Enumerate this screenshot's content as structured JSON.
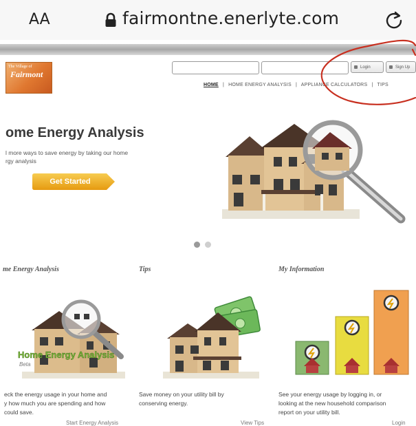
{
  "browser": {
    "text_size_label": "AA",
    "url": "fairmontne.enerlyte.com"
  },
  "header": {
    "logo_small": "The Village of",
    "logo_name": "Fairmont",
    "login_label": "Login",
    "signup_label": "Sign Up",
    "nav": [
      "HOME",
      "|",
      "HOME ENERGY ANALYSIS",
      "|",
      "APPLIANCE CALCULATORS",
      "|",
      "TIPS"
    ]
  },
  "hero": {
    "title": "ome Energy Analysis",
    "subtitle_line1": "l more ways to save energy by taking our home",
    "subtitle_line2": "rgy analysis",
    "cta_label": "Get Started"
  },
  "columns": [
    {
      "title": "me Energy Analysis",
      "image_caption": "Home Energy Analysis",
      "image_caption_sub": "Beta",
      "desc_lines": [
        "eck the energy usage in your home and",
        "y how much you are spending and how",
        "could save."
      ],
      "link": "Start Energy Analysis"
    },
    {
      "title": "Tips",
      "desc_lines": [
        "Save money on your utility bill by",
        "conserving energy."
      ],
      "link": "View Tips"
    },
    {
      "title": "My Information",
      "desc_lines": [
        "See your energy usage by logging in, or",
        "looking at the new household comparison",
        "report on your utility bill."
      ],
      "link": "Login"
    }
  ],
  "colors": {
    "cta": "#f0b020",
    "annotation": "#c83020",
    "logo": "#e07830"
  }
}
